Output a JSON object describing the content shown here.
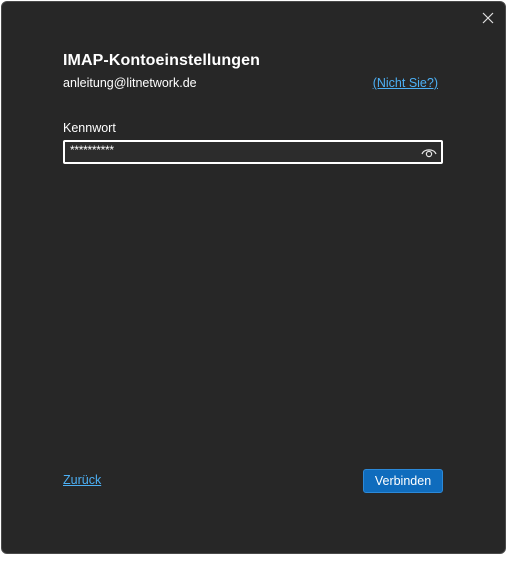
{
  "dialog": {
    "title": "IMAP-Kontoeinstellungen",
    "email": "anleitung@litnetwork.de",
    "not_you_label": "(Nicht Sie?)",
    "close_icon": "close-icon"
  },
  "password": {
    "label": "Kennwort",
    "masked_value": "**********",
    "reveal_icon": "eye-icon"
  },
  "footer": {
    "back_label": "Zurück",
    "connect_label": "Verbinden"
  },
  "colors": {
    "background": "#272727",
    "link": "#4cb0f5",
    "primary_button": "#0f6cbd"
  }
}
